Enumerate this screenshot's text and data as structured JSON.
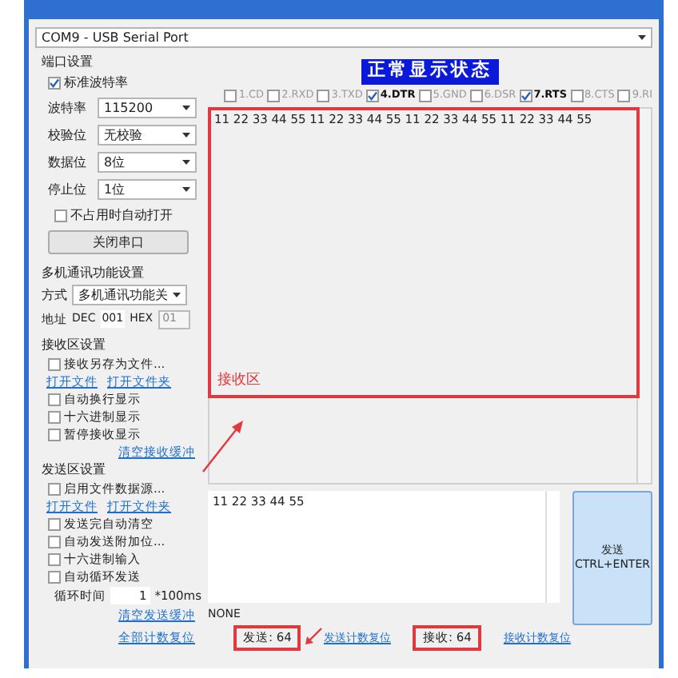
{
  "port_select": {
    "value": "COM9 - USB Serial Port"
  },
  "port_settings": {
    "title": "端口设置",
    "standard_baud": {
      "label": "标准波特率",
      "checked": true
    },
    "fields": [
      {
        "label": "波特率",
        "value": "115200"
      },
      {
        "label": "校验位",
        "value": "无校验"
      },
      {
        "label": "数据位",
        "value": "8位"
      },
      {
        "label": "停止位",
        "value": "1位"
      }
    ],
    "auto_open": {
      "label": "不占用时自动打开",
      "checked": false
    },
    "close_button": "关闭串口"
  },
  "multi": {
    "title": "多机通讯功能设置",
    "mode_label": "方式",
    "mode_value": "多机通讯功能关",
    "address_label": "地址",
    "dec_label": "DEC",
    "dec_value": "001",
    "hex_label": "HEX",
    "hex_value": "01"
  },
  "receive_settings": {
    "title": "接收区设置",
    "items": [
      {
        "kind": "checkbox",
        "label": "接收另存为文件...",
        "checked": false
      },
      {
        "kind": "links",
        "links": [
          "打开文件",
          "打开文件夹"
        ]
      },
      {
        "kind": "checkbox",
        "label": "自动换行显示",
        "checked": false
      },
      {
        "kind": "checkbox",
        "label": "十六进制显示",
        "checked": false
      },
      {
        "kind": "checkbox",
        "label": "暂停接收显示",
        "checked": false
      }
    ],
    "clear_link": "清空接收缓冲"
  },
  "send_settings": {
    "title": "发送区设置",
    "items": [
      {
        "kind": "checkbox",
        "label": "启用文件数据源...",
        "checked": false
      },
      {
        "kind": "links",
        "links": [
          "打开文件",
          "打开文件夹"
        ]
      },
      {
        "kind": "checkbox",
        "label": "发送完自动清空",
        "checked": false
      },
      {
        "kind": "checkbox",
        "label": "自动发送附加位...",
        "checked": false
      },
      {
        "kind": "checkbox",
        "label": "十六进制输入",
        "checked": false
      },
      {
        "kind": "checkbox",
        "label": "自动循环发送",
        "checked": false
      }
    ],
    "loop_label": "循环时间",
    "loop_value": "1",
    "loop_unit": "*100ms",
    "clear_link": "清空发送缓冲"
  },
  "reset_all_link": "全部计数复位",
  "status_banner": "正常显示状态",
  "signals": [
    {
      "label": "1.CD",
      "checked": false
    },
    {
      "label": "2.RXD",
      "checked": false
    },
    {
      "label": "3.TXD",
      "checked": false
    },
    {
      "label": "4.DTR",
      "checked": true
    },
    {
      "label": "5.GND",
      "checked": false
    },
    {
      "label": "6.DSR",
      "checked": false
    },
    {
      "label": "7.RTS",
      "checked": true
    },
    {
      "label": "8.CTS",
      "checked": false
    },
    {
      "label": "9.RI",
      "checked": false
    }
  ],
  "receive_text": "11 22 33 44 55  11 22 33 44 55  11 22 33 44 55  11 22 33 44 55",
  "receive_annotation": "接收区",
  "send_text": "11 22 33 44 55",
  "send_button": {
    "label": "发送",
    "shortcut": "CTRL+ENTER"
  },
  "status_text": "NONE",
  "counters": {
    "sent": "发送: 64",
    "sent_reset": "发送计数复位",
    "received": "接收: 64",
    "received_reset": "接收计数复位"
  }
}
